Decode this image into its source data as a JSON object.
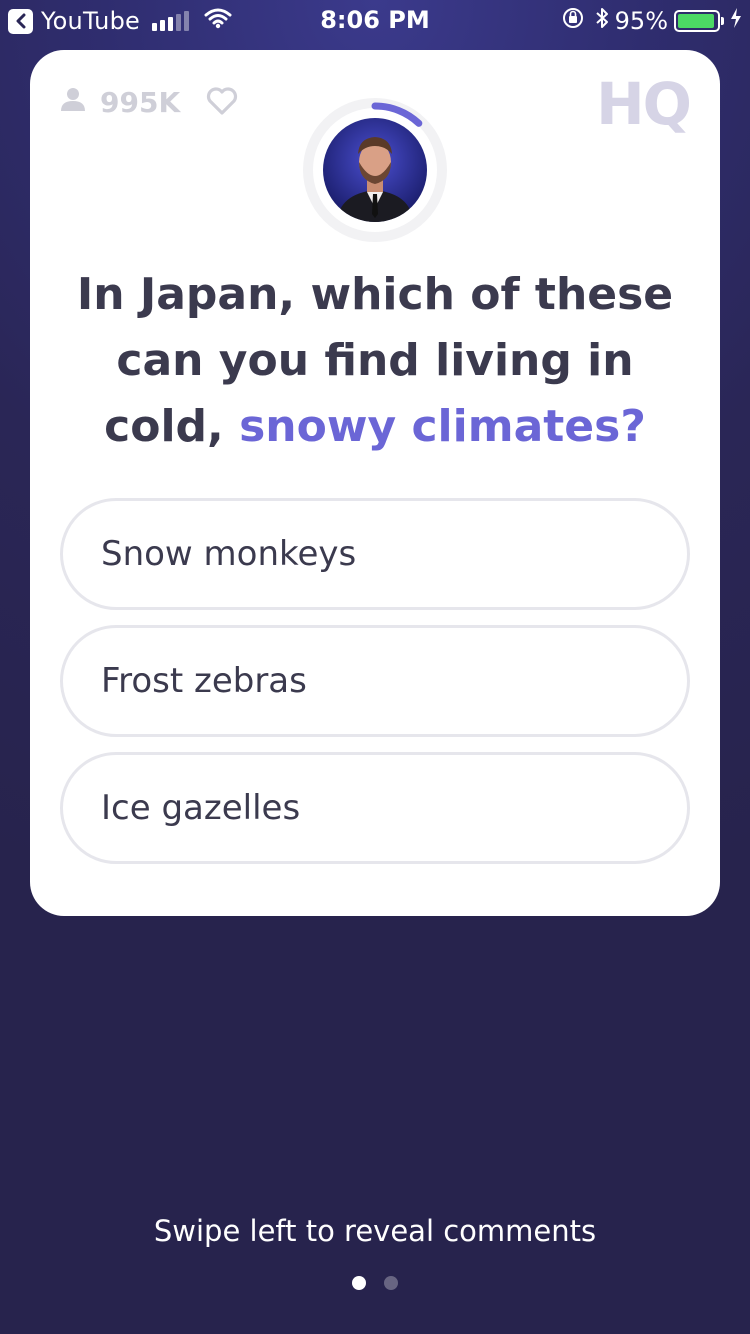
{
  "status_bar": {
    "back_app": "YouTube",
    "time": "8:06 PM",
    "battery_percent": "95%",
    "battery_level": 0.95,
    "icons": [
      "back-arrow-icon",
      "cellular-signal-icon",
      "wifi-icon",
      "orientation-lock-icon",
      "bluetooth-icon",
      "battery-icon",
      "charging-bolt-icon"
    ]
  },
  "card": {
    "viewer_count": "995K",
    "logo": "HQ",
    "icons": [
      "person-icon",
      "heart-icon"
    ],
    "question_plain": "In Japan, which of these can you find living in cold,",
    "question_highlight": "snowy climates?",
    "answers": [
      {
        "label": "Snow monkeys"
      },
      {
        "label": "Frost zebras"
      },
      {
        "label": "Ice gazelles"
      }
    ],
    "timer_progress": 0.12
  },
  "footer": {
    "swipe_hint": "Swipe left to reveal comments",
    "page_count": 2,
    "active_page": 1
  },
  "colors": {
    "background": "#2a2656",
    "accent": "#6b66d6",
    "text": "#3b3a4e",
    "muted": "#cfcfd8",
    "battery": "#4cd964"
  }
}
